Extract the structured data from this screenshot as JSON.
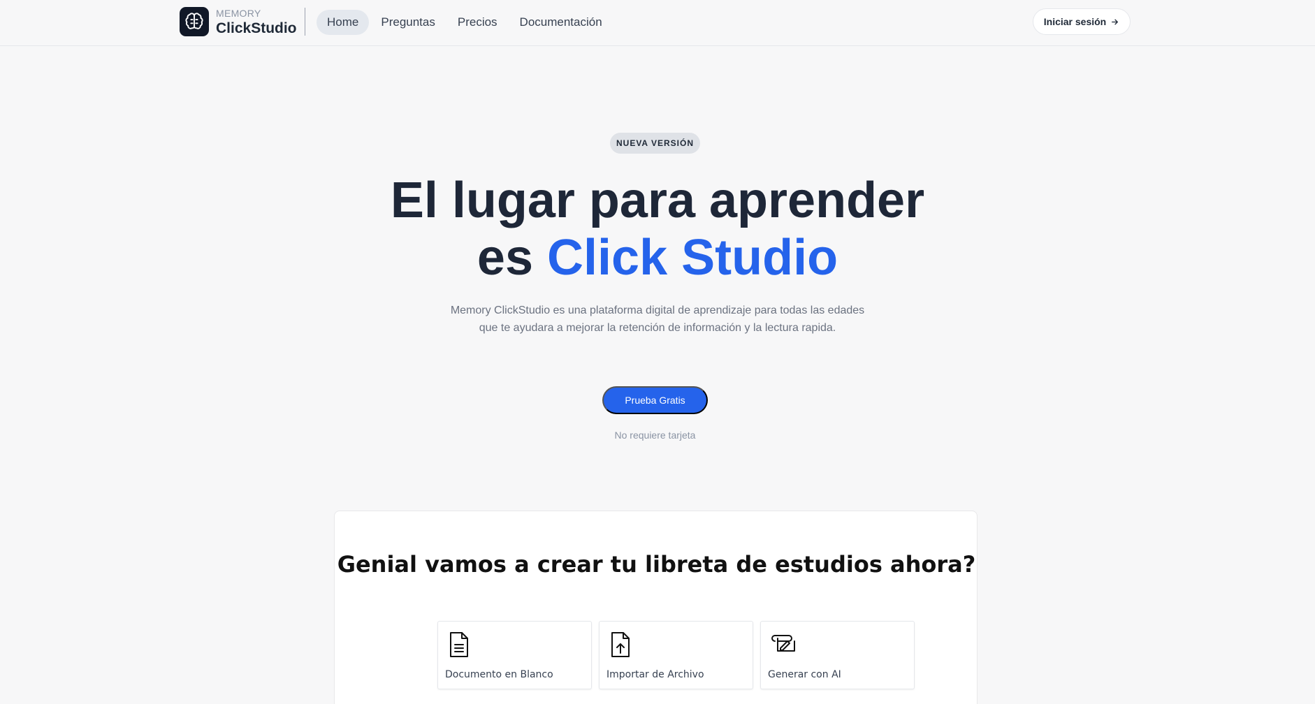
{
  "header": {
    "logo_small": "MEMORY",
    "logo_big": "ClickStudio",
    "nav": [
      {
        "label": "Home",
        "active": true
      },
      {
        "label": "Preguntas"
      },
      {
        "label": "Precios"
      },
      {
        "label": "Documentación"
      }
    ],
    "login_label": "Iniciar sesión"
  },
  "hero": {
    "badge": "NUEVA VERSIÓN",
    "title_line1": "El lugar para aprender",
    "title_line2_prefix": "es ",
    "title_line2_accent": "Click Studio",
    "description": "Memory ClickStudio es una plataforma digital de aprendizaje para todas las edades que te ayudara a mejorar la retención de información y la lectura rapida.",
    "cta_label": "Prueba Gratis",
    "cta_note": "No requiere tarjeta"
  },
  "card": {
    "title": "Genial vamos a crear tu libreta de estudios ahora?",
    "options": [
      {
        "label": "Documento en Blanco",
        "icon": "document-icon"
      },
      {
        "label": "Importar de Archivo",
        "icon": "file-upload-icon"
      },
      {
        "label": "Generar con AI",
        "icon": "scroll-pen-icon"
      }
    ]
  },
  "colors": {
    "accent": "#2563eb",
    "dark": "#1e2738",
    "background": "#f7f7f8"
  }
}
